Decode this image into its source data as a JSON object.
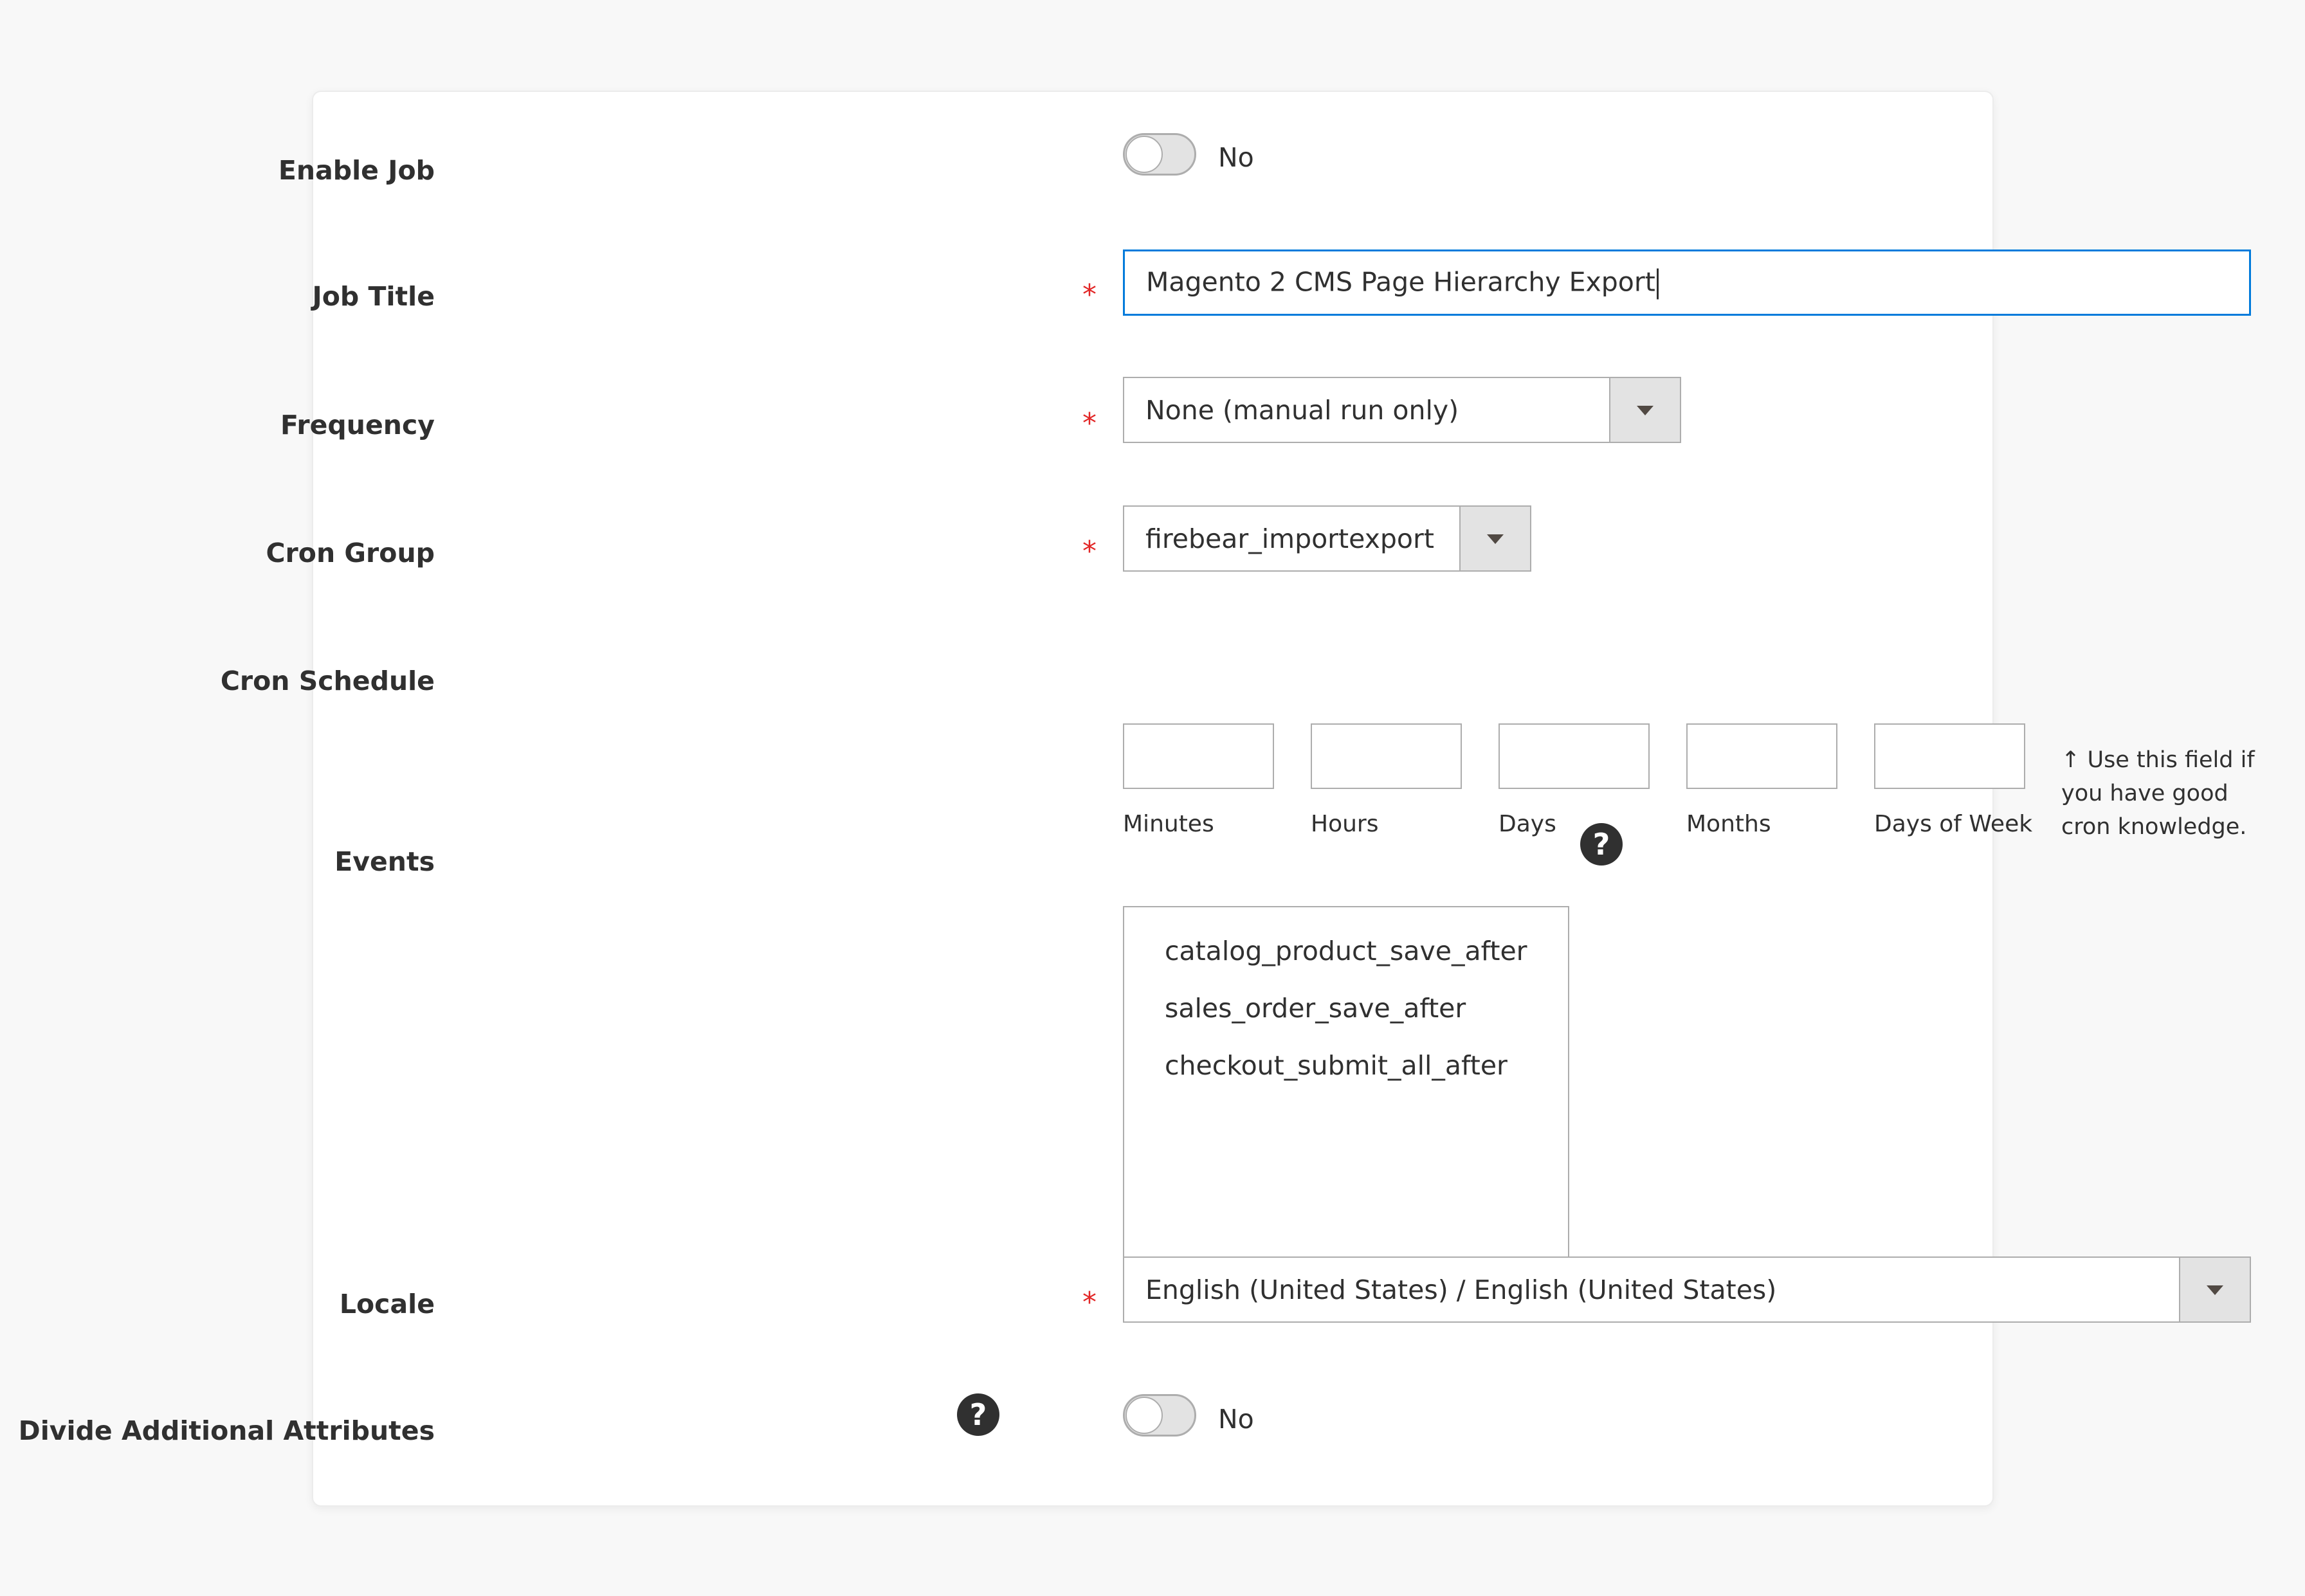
{
  "form": {
    "enable_job": {
      "label": "Enable Job",
      "toggle_text": "No",
      "checked": false
    },
    "job_title": {
      "label": "Job Title",
      "required_mark": "*",
      "value": "Magento 2 CMS Page Hierarchy Export"
    },
    "frequency": {
      "label": "Frequency",
      "required_mark": "*",
      "selected": "None (manual run only)"
    },
    "cron_group": {
      "label": "Cron Group",
      "required_mark": "*",
      "selected": "firebear_importexport"
    },
    "cron_schedule": {
      "label": "Cron Schedule",
      "fields": [
        "Minutes",
        "Hours",
        "Days",
        "Months",
        "Days of Week"
      ],
      "note": "↑ Use this field if you have good cron knowledge."
    },
    "events": {
      "label": "Events",
      "options": [
        "catalog_product_save_after",
        "sales_order_save_after",
        "checkout_submit_all_after"
      ],
      "help": "?"
    },
    "locale": {
      "label": "Locale",
      "required_mark": "*",
      "selected": "English (United States) / English (United States)"
    },
    "divide_attributes": {
      "label": "Divide Additional Attributes",
      "toggle_text": "No",
      "checked": false,
      "help": "?"
    }
  },
  "colors": {
    "required": "#e22626",
    "focus_border": "#007bdb",
    "toggle_off": "#e3e3e3",
    "help_icon": "#303030"
  },
  "icons": {
    "select_arrow": "chevron-down-icon",
    "help": "help-icon",
    "resize": "resize-handle-icon"
  }
}
